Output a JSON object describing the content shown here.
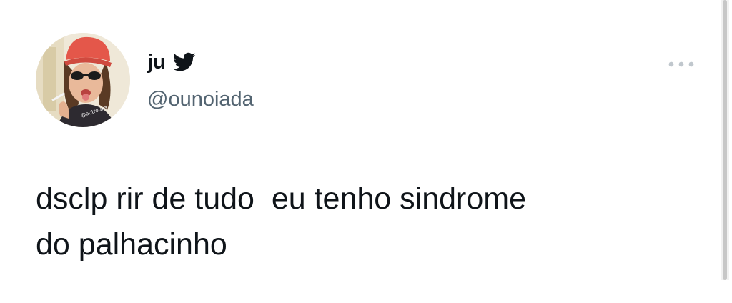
{
  "tweet": {
    "author": {
      "display_name": "ju",
      "handle": "@ounoiada",
      "avatar_watermark": "@outrouxa"
    },
    "text": "dsclp rir de tudo  eu tenho sindrome\ndo palhacinho",
    "icons": {
      "platform": "twitter-bird-icon",
      "more": "more-options-icon"
    }
  },
  "colors": {
    "text_primary": "#0f1419",
    "text_secondary": "#536471",
    "bird_icon": "#0f1419",
    "more_dots": "#c0c7cd",
    "background": "#ffffff"
  }
}
